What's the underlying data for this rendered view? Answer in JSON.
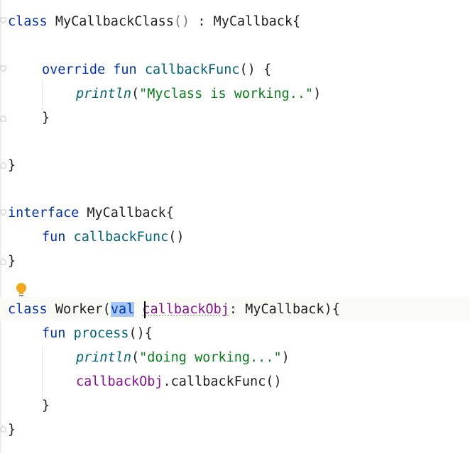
{
  "code": {
    "l1": {
      "kw": "class",
      "name": "MyCallbackClass",
      "parens": "()",
      "colon": " : ",
      "super": "MyCallback",
      "brace": "{"
    },
    "l2": {
      "kw1": "override",
      "kw2": "fun",
      "name": "callbackFunc",
      "rest": "() {"
    },
    "l3": {
      "fn": "println",
      "open": "(",
      "str": "\"Myclass is working..\"",
      "close": ")"
    },
    "l4": {
      "text": "}"
    },
    "l5": {
      "text": "}"
    },
    "l6": {
      "kw": "interface",
      "name": "MyCallback",
      "brace": "{"
    },
    "l7": {
      "kw": "fun",
      "name": "callbackFunc",
      "rest": "()"
    },
    "l8": {
      "text": "}"
    },
    "l9": {
      "kw": "class",
      "name": "Worker",
      "open": "(",
      "val": "val",
      "param": "callbackObj",
      "colon": ": ",
      "type": "MyCallback",
      "rest": "){"
    },
    "l10": {
      "kw": "fun",
      "name": "process",
      "rest": "(){"
    },
    "l11": {
      "fn": "println",
      "open": "(",
      "str": "\"doing working...\"",
      "close": ")"
    },
    "l12": {
      "obj": "callbackObj",
      "dot": ".",
      "method": "callbackFunc",
      "rest": "()"
    },
    "l13": {
      "text": "}"
    },
    "l14": {
      "text": "}"
    }
  },
  "colors": {
    "keyword": "#0033b3",
    "function": "#00627a",
    "string": "#067d17",
    "parameter": "#871094",
    "selection": "#a6c8f5",
    "bulb": "#f2a91d"
  },
  "icons": {
    "intention": "lightbulb-icon",
    "fold": "fold-marker-icon",
    "caret": "text-cursor-icon"
  }
}
